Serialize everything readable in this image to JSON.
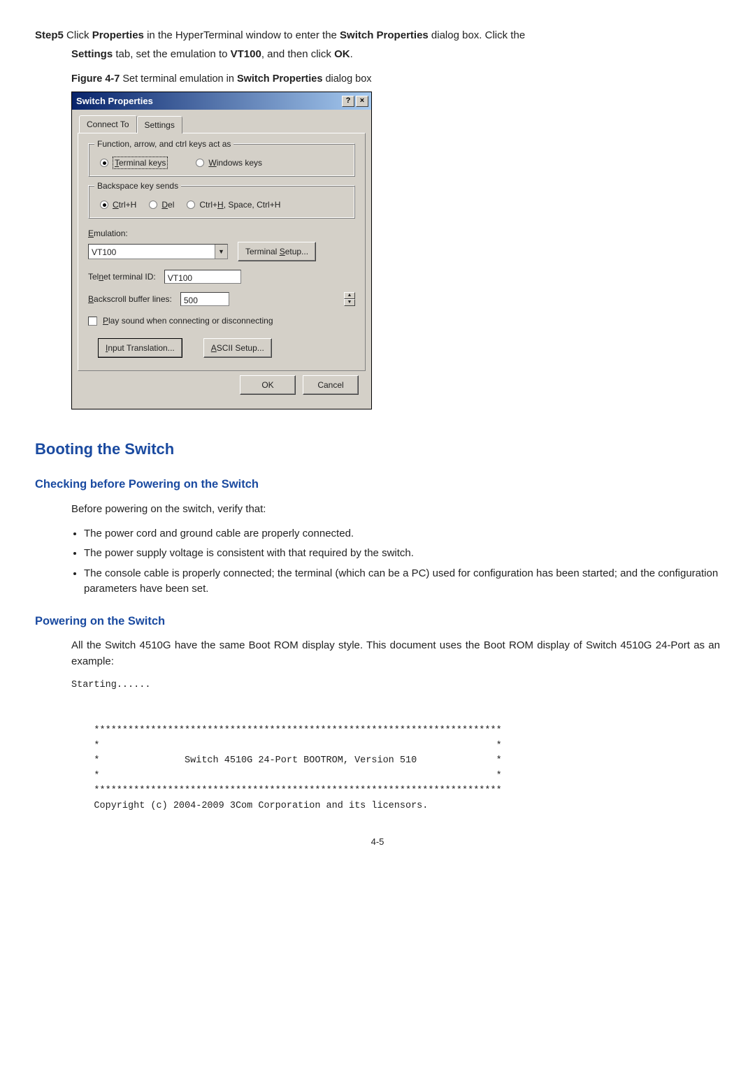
{
  "step": {
    "label": "Step5",
    "line1_pre": "Click ",
    "line1_b1": "Properties",
    "line1_mid1": " in the HyperTerminal window to enter the ",
    "line1_b2": "Switch Properties",
    "line1_post1": " dialog box. Click the",
    "line2_b1": "Settings",
    "line2_mid1": " tab, set the emulation to ",
    "line2_b2": "VT100",
    "line2_mid2": ", and then click ",
    "line2_b3": "OK",
    "line2_end": "."
  },
  "figure": {
    "prefix": "Figure 4-7 ",
    "mid": "Set terminal emulation in ",
    "bold": "Switch Properties",
    "suffix": " dialog box"
  },
  "dialog": {
    "title": "Switch Properties",
    "help": "?",
    "close": "×",
    "tabs": {
      "t1": "Connect To",
      "t2": "Settings"
    },
    "group1": {
      "title": "Function, arrow, and ctrl keys act as",
      "r1_pre": "T",
      "r1_text": "erminal keys",
      "r2_pre": "W",
      "r2_text": "indows keys"
    },
    "group2": {
      "title": "Backspace key sends",
      "r1_pre": "C",
      "r1_text": "trl+H",
      "r2_pre": "D",
      "r2_text": "el",
      "r3_text_a": "Ctrl+",
      "r3_pre": "H",
      "r3_text_b": ", Space, Ctrl+H"
    },
    "emulation": {
      "label_pre": "E",
      "label_text": "mulation:",
      "value": "VT100",
      "btn_pre": "Terminal ",
      "btn_u": "S",
      "btn_post": "etup..."
    },
    "telnet": {
      "label_a": "Tel",
      "label_u": "n",
      "label_b": "et terminal ID:",
      "value": "VT100"
    },
    "backscroll": {
      "label_u": "B",
      "label_text": "ackscroll buffer lines:",
      "value": "500"
    },
    "play": {
      "label_u": "P",
      "label_text": "lay sound when connecting or disconnecting"
    },
    "inputbtn": {
      "u": "I",
      "text": "nput Translation..."
    },
    "asciibtn": {
      "u": "A",
      "text": "SCII Setup..."
    },
    "ok": "OK",
    "cancel": "Cancel"
  },
  "section": "Booting the Switch",
  "sub1": "Checking before Powering on the Switch",
  "verify": "Before powering on the switch, verify that:",
  "bullets": {
    "b1": "The power cord and ground cable are properly connected.",
    "b2": "The power supply voltage is consistent with that required by the switch.",
    "b3": "The console cable is properly connected; the terminal (which can be a PC) used for configuration has been started; and the configuration parameters have been set."
  },
  "sub2": "Powering on the Switch",
  "p2": "All the Switch 4510G have the same Boot ROM display style. This document uses the Boot ROM display of Switch 4510G 24-Port as an example:",
  "code": "Starting......\n\n\n    ************************************************************************\n    *                                                                      *\n    *               Switch 4510G 24-Port BOOTROM, Version 510              *\n    *                                                                      *\n    ************************************************************************\n    Copyright (c) 2004-2009 3Com Corporation and its licensors.",
  "pagenum": "4-5"
}
